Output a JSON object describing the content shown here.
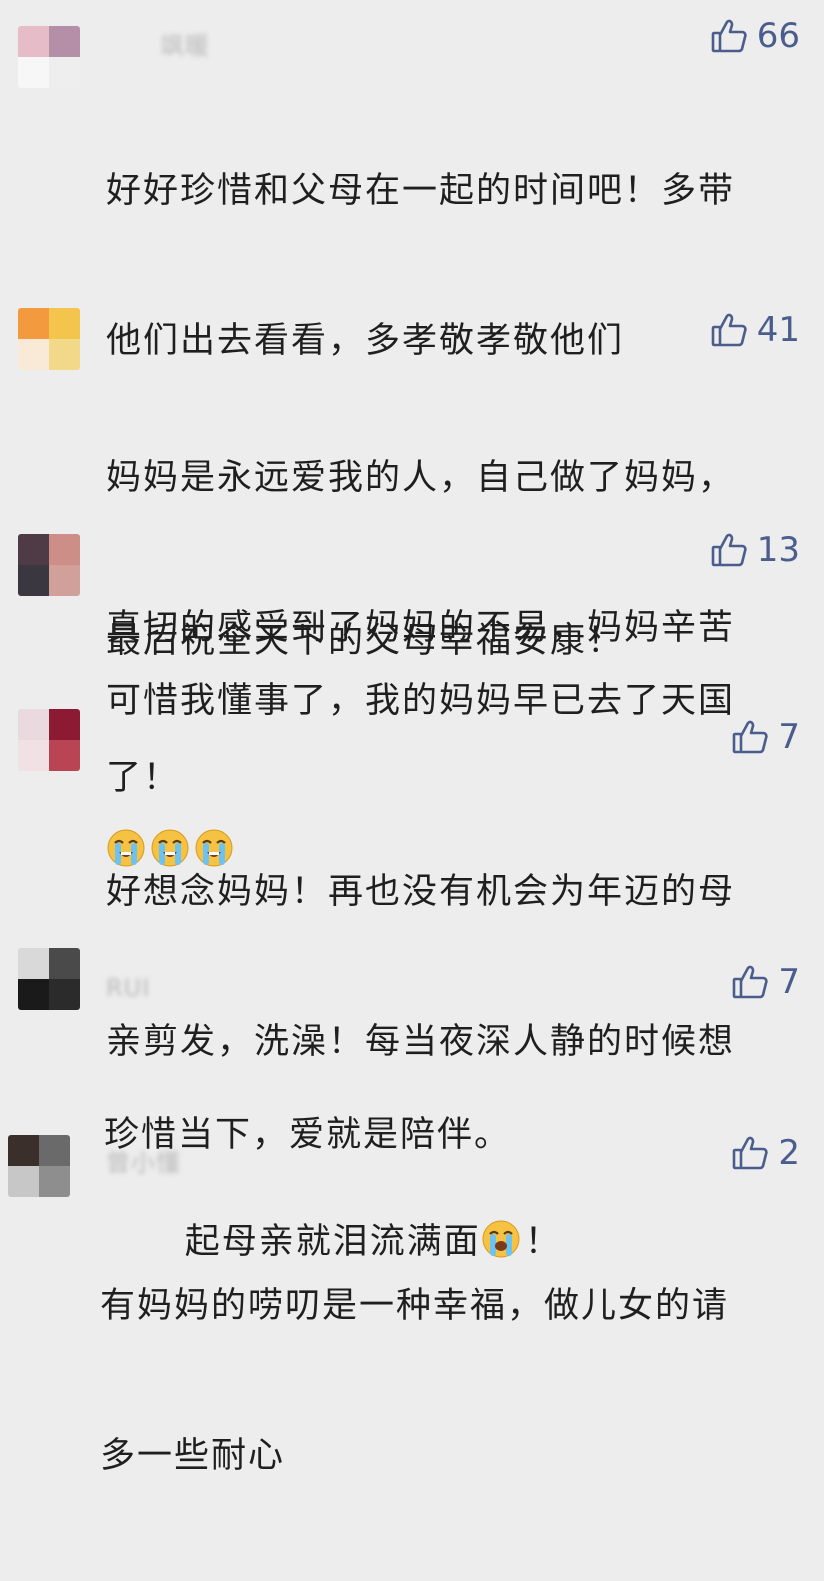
{
  "comments": [
    {
      "username": "飒暖",
      "likes": "66",
      "lines": [
        "好好珍惜和父母在一起的时间吧！多带",
        "他们出去看看，多孝敬孝敬他们",
        "",
        "最后祝全天下的父母幸福安康！"
      ],
      "avatar_colors": [
        "#e6bcc9",
        "#b58fa7",
        "#f7f7f7",
        "#eeeeee"
      ]
    },
    {
      "username": "",
      "likes": "41",
      "lines": [
        "妈妈是永远爱我的人，自己做了妈妈，",
        "真切的感受到了妈妈的不易，妈妈辛苦",
        "了！"
      ],
      "avatar_colors": [
        "#f29a3d",
        "#f3c54d",
        "#f8ead7",
        "#f2d889"
      ]
    },
    {
      "username": "",
      "likes": "13",
      "lines": [
        "可惜我懂事了，我的妈妈早已去了天国"
      ],
      "emoji_line": [
        "crying",
        "crying",
        "crying"
      ],
      "avatar_colors": [
        "#4f3b45",
        "#cc8e87",
        "#3a3741",
        "#d1a09a"
      ]
    },
    {
      "username": "",
      "likes": "7",
      "lines": [
        "好想念妈妈！再也没有机会为年迈的母",
        "亲剪发，洗澡！每当夜深人静的时候想",
        "起母亲就泪流满面"
      ],
      "trailing_emoji": "sobbing",
      "trailing_text": "！",
      "avatar_colors": [
        "#ead9df",
        "#8c1a32",
        "#f1e0e4",
        "#b84454"
      ]
    },
    {
      "username": "RUI",
      "likes": "7",
      "lines": [
        "珍惜当下，爱就是陪伴。"
      ],
      "avatar_colors": [
        "#d9d9d9",
        "#4a4a4a",
        "#1a1a1a",
        "#2b2b2b"
      ]
    },
    {
      "username": "曾小懂",
      "likes": "2",
      "lines": [
        "有妈妈的唠叨是一种幸福，做儿女的请",
        "多一些耐心"
      ],
      "avatar_colors": [
        "#3a2f2a",
        "#6a6a6a",
        "#c7c7c7",
        "#8e8e8e"
      ]
    }
  ],
  "icons": {
    "like": "thumbs-up-icon",
    "crying": "loudly-crying-face-icon",
    "sobbing": "sobbing-face-icon"
  },
  "colors": {
    "background": "#ededed",
    "like": "#4a5d8c",
    "text": "#1f1f1f"
  }
}
